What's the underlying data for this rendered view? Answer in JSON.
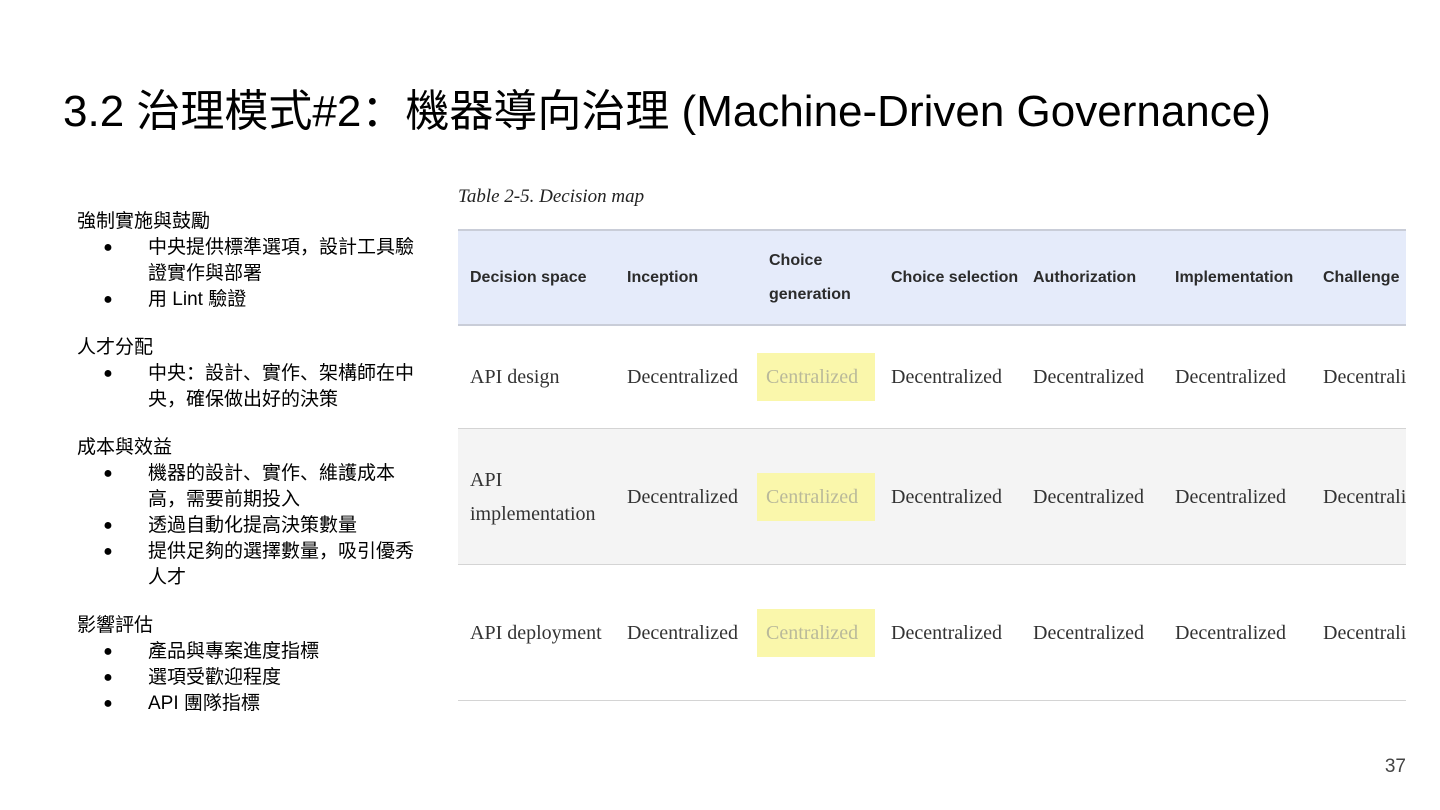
{
  "slide": {
    "title": "3.2 治理模式#2：機器導向治理 (Machine-Driven Governance)",
    "page_number": "37"
  },
  "sections": [
    {
      "heading": "強制實施與鼓勵",
      "bullets": [
        "中央提供標準選項，設計工具驗證實作與部署",
        "用 Lint 驗證"
      ]
    },
    {
      "heading": "人才分配",
      "bullets": [
        "中央：設計、實作、架構師在中央，確保做出好的決策"
      ]
    },
    {
      "heading": "成本與效益",
      "bullets": [
        "機器的設計、實作、維護成本高，需要前期投入",
        "透過自動化提高決策數量",
        "提供足夠的選擇數量，吸引優秀人才"
      ]
    },
    {
      "heading": "影響評估",
      "bullets": [
        "產品與專案進度指標",
        "選項受歡迎程度",
        "API 團隊指標"
      ]
    }
  ],
  "bullet_glyph": "●",
  "table": {
    "caption": "Table 2-5. Decision map",
    "headers": [
      "Decision space",
      "Inception",
      "Choice generation",
      "Choice selection",
      "Authorization",
      "Implementation",
      "Challenge"
    ],
    "rows": [
      [
        "API design",
        "Decentralized",
        "Centralized",
        "Decentralized",
        "Decentralized",
        "Decentralized",
        "Decentralized"
      ],
      [
        "API implementation",
        "Decentralized",
        "Centralized",
        "Decentralized",
        "Decentralized",
        "Decentralized",
        "Decentralized"
      ],
      [
        "API deployment",
        "Decentralized",
        "Centralized",
        "Decentralized",
        "Decentralized",
        "Decentralized",
        "Decentralized"
      ]
    ],
    "highlight_column": 2,
    "header_bg": "#e5ebfa",
    "highlight_bg": "#faf7ab"
  }
}
